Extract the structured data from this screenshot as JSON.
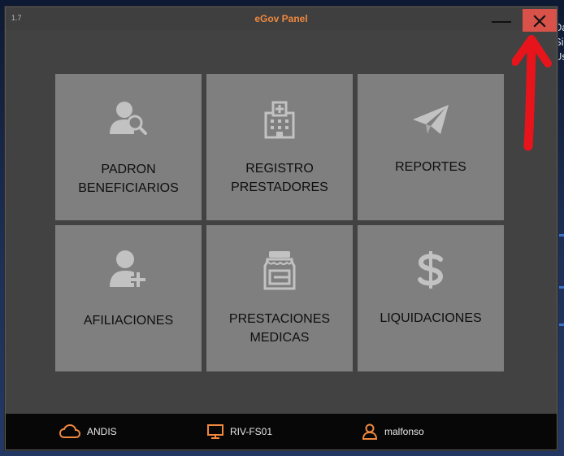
{
  "window": {
    "version": "1.7",
    "title": "eGov Panel"
  },
  "tiles": [
    {
      "label_line1": "PADRON",
      "label_line2": "BENEFICIARIOS",
      "icon": "user-search-icon"
    },
    {
      "label_line1": "REGISTRO",
      "label_line2": "PRESTADORES",
      "icon": "hospital-icon"
    },
    {
      "label_line1": "REPORTES",
      "label_line2": "",
      "icon": "paper-plane-icon"
    },
    {
      "label_line1": "AFILIACIONES",
      "label_line2": "",
      "icon": "user-add-icon"
    },
    {
      "label_line1": "PRESTACIONES",
      "label_line2": "MEDICAS",
      "icon": "medicine-jar-icon"
    },
    {
      "label_line1": "LIQUIDACIONES",
      "label_line2": "",
      "icon": "dollar-icon"
    }
  ],
  "status": {
    "server": "ANDIS",
    "host": "RIV-FS01",
    "user": "malfonso"
  },
  "colors": {
    "title": "#f0883e",
    "accent": "#f0883e",
    "tile": "#7f7f7f",
    "close_button": "#d8524a",
    "annotation": "#e8141c"
  },
  "background_text": [
    "Da",
    "Si",
    "Us"
  ]
}
